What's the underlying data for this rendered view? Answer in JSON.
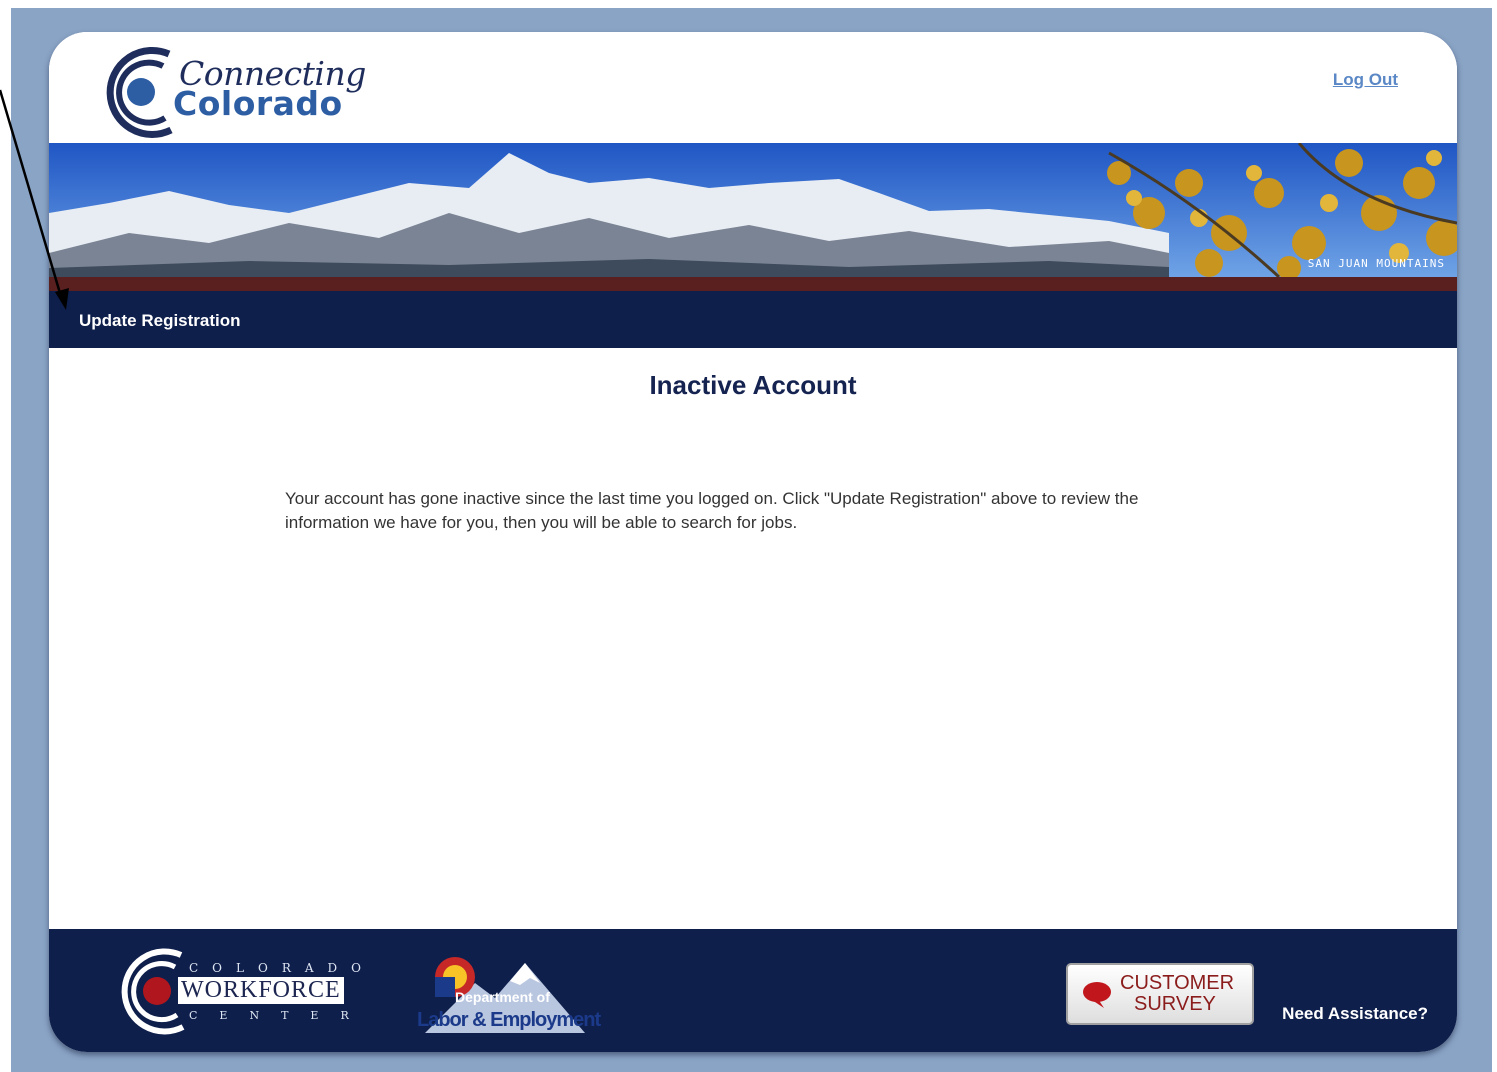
{
  "header": {
    "logo_line_1": "Connecting",
    "logo_line_2": "Colorado",
    "logout_label": "Log Out"
  },
  "banner": {
    "caption": "SAN JUAN MOUNTAINS"
  },
  "nav": {
    "update_registration_label": "Update Registration"
  },
  "main": {
    "title": "Inactive Account",
    "message": "Your account has gone inactive since the last time you logged on. Click \"Update Registration\" above to review the information we have for you, then you will be able to search for jobs."
  },
  "footer": {
    "cwc_top": "COLORADO",
    "cwc_middle": "WORKFORCE",
    "cwc_bottom": "CENTER",
    "dle_line_1": "Department of",
    "dle_line_2": "Labor & Employment",
    "survey_line_1": "CUSTOMER",
    "survey_line_2": "SURVEY",
    "assistance_label": "Need Assistance?"
  },
  "colors": {
    "frame": "#8aa4c6",
    "navy": "#0f1f4c",
    "maroon": "#5a2020",
    "link": "#5a87c5"
  }
}
